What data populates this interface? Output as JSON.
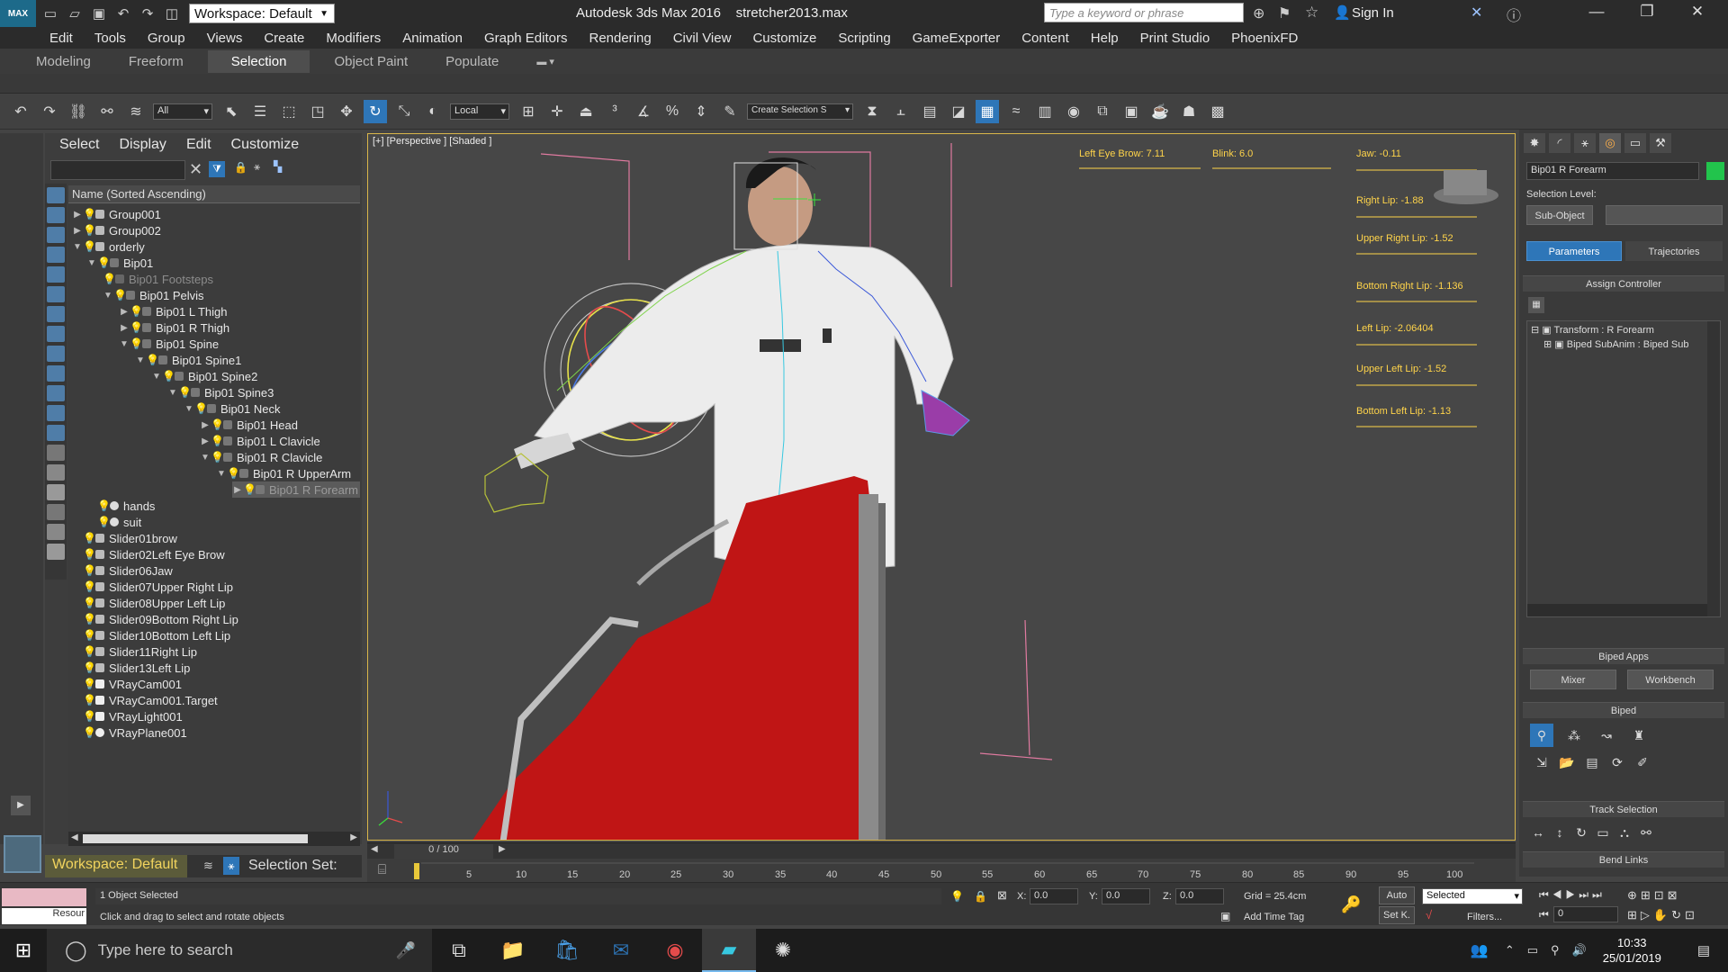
{
  "app": {
    "logo_text": "MAX",
    "workspace": "Workspace: Default",
    "title": "Autodesk 3ds Max 2016",
    "filename": "stretcher2013.max",
    "search_placeholder": "Type a keyword or phrase",
    "sign_in": "Sign In",
    "accent_color": "#2e76b8"
  },
  "menu": [
    "Edit",
    "Tools",
    "Group",
    "Views",
    "Create",
    "Modifiers",
    "Animation",
    "Graph Editors",
    "Rendering",
    "Civil View",
    "Customize",
    "Scripting",
    "GameExporter",
    "Content",
    "Help",
    "Print Studio",
    "PhoenixFD"
  ],
  "ribbon_tabs": [
    "Modeling",
    "Freeform",
    "Selection",
    "Object Paint",
    "Populate"
  ],
  "ribbon_active": "Selection",
  "toolbar": {
    "filter": "All",
    "coord": "Local",
    "selection_set": "Create Selection S"
  },
  "scene_explorer": {
    "menu": [
      "Select",
      "Display",
      "Edit",
      "Customize"
    ],
    "column_header": "Name (Sorted Ascending)",
    "rows": [
      {
        "label": "Group001"
      },
      {
        "label": "Group002"
      },
      {
        "label": "orderly"
      },
      {
        "label": "Bip01"
      },
      {
        "label": "Bip01 Footsteps"
      },
      {
        "label": "Bip01 Pelvis"
      },
      {
        "label": "Bip01 L Thigh"
      },
      {
        "label": "Bip01 R Thigh"
      },
      {
        "label": "Bip01 Spine"
      },
      {
        "label": "Bip01 Spine1"
      },
      {
        "label": "Bip01 Spine2"
      },
      {
        "label": "Bip01 Spine3"
      },
      {
        "label": "Bip01 Neck"
      },
      {
        "label": "Bip01 Head"
      },
      {
        "label": "Bip01 L Clavicle"
      },
      {
        "label": "Bip01 R Clavicle"
      },
      {
        "label": "Bip01 R UpperArm"
      },
      {
        "label": "Bip01 R Forearm"
      },
      {
        "label": "hands"
      },
      {
        "label": "suit"
      },
      {
        "label": "Slider01brow"
      },
      {
        "label": "Slider02Left Eye Brow"
      },
      {
        "label": "Slider06Jaw"
      },
      {
        "label": "Slider07Upper Right Lip"
      },
      {
        "label": "Slider08Upper Left Lip"
      },
      {
        "label": "Slider09Bottom Right Lip"
      },
      {
        "label": "Slider10Bottom Left Lip"
      },
      {
        "label": "Slider11Right Lip"
      },
      {
        "label": "Slider13Left Lip"
      },
      {
        "label": "VRayCam001"
      },
      {
        "label": "VRayCam001.Target"
      },
      {
        "label": "VRayLight001"
      },
      {
        "label": "VRayPlane001"
      }
    ],
    "workspace_label": "Workspace: Default",
    "selection_set_label": "Selection Set:"
  },
  "viewport": {
    "label": "[+] [Perspective ] [Shaded ]",
    "sliders": {
      "left_eye_brow": "Left Eye Brow: 7.11",
      "blink": "Blink: 6.0",
      "jaw": "Jaw: -0.11",
      "right_lip": "Right Lip: -1.88",
      "upper_right_lip": "Upper Right Lip: -1.52",
      "bottom_right_lip": "Bottom Right Lip: -1.136",
      "left_lip": "Left Lip: -2.06404",
      "upper_left_lip": "Upper Left Lip: -1.52",
      "bottom_left_lip": "Bottom Left Lip: -1.13"
    }
  },
  "command_panel": {
    "object_name": "Bip01 R Forearm",
    "object_color": "#22c44c",
    "selection_level": "Selection Level:",
    "sub_object": "Sub-Object",
    "tab_parameters": "Parameters",
    "tab_trajectories": "Trajectories",
    "assign_controller": "Assign Controller",
    "controller_items": [
      "Transform : R Forearm",
      "Biped SubAnim : Biped Sub"
    ],
    "biped_apps": "Biped Apps",
    "mixer": "Mixer",
    "workbench": "Workbench",
    "biped": "Biped",
    "track_selection": "Track Selection",
    "bend_links": "Bend Links"
  },
  "timeline": {
    "frame": "0 / 100",
    "ticks": [
      "5",
      "10",
      "15",
      "20",
      "25",
      "30",
      "35",
      "40",
      "45",
      "50",
      "55",
      "60",
      "65",
      "70",
      "75",
      "80",
      "85",
      "90",
      "95",
      "100"
    ]
  },
  "status": {
    "objects_selected": "1 Object Selected",
    "prompt": "Click and drag to select and rotate objects",
    "resource": "Resour",
    "x_label": "X:",
    "x_value": "0.0",
    "y_label": "Y:",
    "y_value": "0.0",
    "z_label": "Z:",
    "z_value": "0.0",
    "grid": "Grid = 25.4cm",
    "add_time_tag": "Add Time Tag",
    "auto": "Auto",
    "set_key": "Set K.",
    "key_filter": "Selected",
    "filters": "Filters...",
    "frame_field": "0"
  },
  "taskbar": {
    "search": "Type here to search",
    "time": "10:33",
    "date": "25/01/2019"
  }
}
